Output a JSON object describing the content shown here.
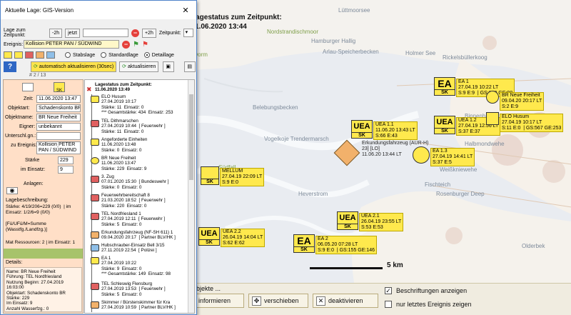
{
  "window": {
    "title": "Aktuelle Lage: GIS-Version",
    "close_glyph": "✕"
  },
  "controls": {
    "time_label": "Lage zum Zeitpunkt:",
    "minus2h": "-2h",
    "now": "jetzt",
    "plus2h": "+2h",
    "zeitpunkt_label": "Zeitpunkt:",
    "event_label": "Ereignis:",
    "event_value": "Kollision PETER PAN / SÜDWIND",
    "radio_stab": "Stabslage",
    "radio_standard": "Standardlage",
    "radio_detail": "Detaillage",
    "auto_update": "automatisch aktualisieren (30sec)",
    "update": "aktualisieren",
    "counter": "# 2 / 13"
  },
  "details_form": {
    "sk_badge": "SK",
    "zeit_label": "Zeit:",
    "zeit_value": "11.06.2020  13:47",
    "objektart_label": "Objektart:",
    "objektart_value": "Schadenskonto BR",
    "objektname_label": "Objektname:",
    "objektname_value": "BR Neue Freiheit",
    "eigner_label": "Eigner:",
    "eigner_value": "unbekannt",
    "unterschl_label": "Unterschl.gn.:",
    "unterschl_value": "",
    "ereignis_label": "zu Ereignis:",
    "ereignis_value": "Kollision PETER PAN / SÜDWIND",
    "staerke_label": "Stärke",
    "staerke_value": "229",
    "einsatz_label": "im Einsatz:",
    "einsatz_value": "9",
    "anlagen_label": "Anlagen:",
    "lagebeschreibung_label": "Lagebeschreibung:",
    "lagebeschreibung_text": "Stärke: 4/19/206=229 (0/0)  | im\nEinsatz: 1/2/6=9 (0/0)\n\n[Fü/UFü/M=Summe\n(Wasstfg./Landfzg.)]",
    "mat_ressourcen": "Mat Ressourcen: 2  | im Einsatz: 1",
    "details_label": "Details:",
    "details_text": "Name: BR Neue Freiheit\nFührung: TEL Nordfriesland\nNutzung Beginn: 27.04.2019\n16:03:00\nObjektart: Schadenskonto BR\nStärke: 229\nIm Einsatz: 9\nAnzahl Wasserfzg.: 0"
  },
  "tree": {
    "root": "Lagestatus zum Zeitpunkt:\n11.06.2020 13:49",
    "items": [
      {
        "text": "ELO Husum\n27.04.2019 10:17\nStärke: 11  Einsatz: 0\n*** Gesamtstärke: 434  Einsatz: 253",
        "icon": "#ffe94d"
      },
      {
        "text": "TEL Dithmarschen\n27.04.2019 10:44  [ Feuerwehr ]\nStärke: 11  Einsatz: 0",
        "icon": "#e06060"
      },
      {
        "text": "Angeforderte Einheiten\n11.06.2020 13:48\nStärke: 0  Einsatz: 0",
        "icon": "#ffe94d"
      },
      {
        "text": "BR Neue Freiheit\n11.06.2020 13:47\nStärke: 229  Einsatz: 9",
        "icon": "#ffe94d",
        "selected": true
      },
      {
        "text": "3. Zug\n07.01.2020 15:30  [ Bundeswehr ]\nStärke: 0  Einsatz: 0",
        "icon": "#e06060"
      },
      {
        "text": "Feuerwehrbereitschaft 8\n21.03.2020 18:52  [ Feuerwehr ]\nStärke: 220  Einsatz: 0",
        "icon": "#e06060"
      },
      {
        "text": "TEL Nordfriesland 1\n27.04.2019 12:11  [ Feuerwehr ]\nStärke: 5  Einsatz: 0",
        "icon": "#e06060"
      },
      {
        "text": "Erkundungsfahrzeug (NF-SH 611) 1\n09.04.2020 20:17  [ Partner BLV/HK ]",
        "icon": "#f2b16b"
      },
      {
        "text": "Hubschrauber-Einsatz Bell 3/15\n27.11.2019 22:54  [ Polizei ]",
        "icon": "#8fbfe8"
      },
      {
        "text": "EA 1\n27.04.2019 10:22\nStärke: 9  Einsatz: 0\n*** Gesamtstärke: 149  Einsatz: 98",
        "icon": "#ffe94d"
      },
      {
        "text": "TEL Schleswig Flensburg\n27.04.2019 13:53  [ Feuerwehr ]\nStärke: 5  Einsatz: 0",
        "icon": "#e06060"
      },
      {
        "text": "Skimmer / Bürstenskimmer für Kra\n27.04.2019 10:59  [ Partner BLV/HK ]",
        "icon": "#f2b16b"
      }
    ]
  },
  "map": {
    "title_line1": "Lagestatus zum Zeitpunkt:",
    "title_line2": "11.06.2020 13:44",
    "scale_label": "5 km",
    "places": [
      {
        "name": "Lüttmoorsee",
        "cls": ""
      },
      {
        "name": "Nordstrandischmoor",
        "cls": "green"
      },
      {
        "name": "Hamburger Hallig",
        "cls": ""
      },
      {
        "name": "Arlau-Speicherbecken",
        "cls": ""
      },
      {
        "name": "Holmer See",
        "cls": ""
      },
      {
        "name": "Rickelsbüllerkoog",
        "cls": ""
      },
      {
        "name": "Pellworm",
        "cls": "green"
      },
      {
        "name": "Belebungsbecken",
        "cls": ""
      },
      {
        "name": "Vogelkoje Trendermarsch",
        "cls": ""
      },
      {
        "name": "Binnenhafen",
        "cls": ""
      },
      {
        "name": "Halbmondwehe",
        "cls": ""
      },
      {
        "name": "Südfall",
        "cls": "green"
      },
      {
        "name": "Weißkniewehe",
        "cls": ""
      },
      {
        "name": "Fischteich",
        "cls": ""
      },
      {
        "name": "Rosenburger Deep",
        "cls": ""
      },
      {
        "name": "Heverstrom",
        "cls": ""
      },
      {
        "name": "Olderbek",
        "cls": ""
      }
    ],
    "units": [
      {
        "big": "EA",
        "small": "SK",
        "label": "EA 1\n27.04.19 10:22 LT\nS:9 E:9  | GS:149 GE:98"
      },
      {
        "big": "UEA",
        "small": "SK",
        "label": "UEA 1.1\n11.06.20 13:43 LT\nS:66 E:43"
      },
      {
        "big": "UEA",
        "small": "SK",
        "label": "UEA 1.2\n27.04.19 12:56 LT\nS:37 E:37"
      },
      {
        "big": "EA",
        "small": "SK",
        "label": "BR Neue Freiheit\n09.04.20 20:17 LT\nS:2 E:9"
      },
      {
        "big": "EA",
        "small": "SK",
        "label": "ELO Husum\n27.04.19 10:17 LT\nS:11 E:0  | GS:567 GE:253"
      },
      {
        "big": "",
        "small": "SK",
        "label": "EA 1.3\n27.04.19 14:41 LT\nS:37 E:5"
      },
      {
        "big": "",
        "small": "SK",
        "label": "MELLUM\n27.04.19 22:09 LT\nS:9 E:0"
      },
      {
        "big": "UEA",
        "small": "SK",
        "label": "UEA 2.1\n26.04.19 23:55 LT\nS:53 E:53"
      },
      {
        "big": "UEA",
        "small": "SK",
        "label": "UEA 2.2\n26.04.19 14:04 LT\nS:62 E:62"
      },
      {
        "big": "EA",
        "small": "SK",
        "label": "EA 2\n06.05.20 07:28 LT\nS:9 E:0  | GS:155 GE:146"
      }
    ],
    "vehicle_label": "Erkundungsfahrzeug (AUR-H)\n23] [LO]\n11.06.20 13:44 LT",
    "bottom": {
      "truncated": "geobjekte ...",
      "informieren": "informieren",
      "verschieben": "verschieben",
      "deaktivieren": "deaktivieren",
      "beschriftungen": "Beschriftungen anzeigen",
      "nur_letztes": "nur letztes Ereignis zeigen"
    }
  }
}
